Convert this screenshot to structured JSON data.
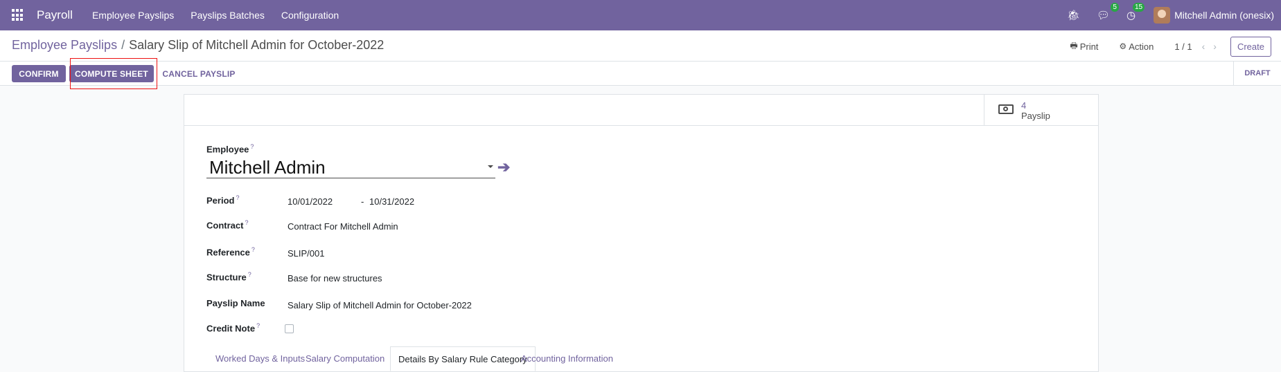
{
  "navbar": {
    "app_name": "Payroll",
    "menu": [
      "Employee Payslips",
      "Payslips Batches",
      "Configuration"
    ],
    "messages_count": "5",
    "activities_count": "15",
    "user": "Mitchell Admin (onesix)"
  },
  "control_panel": {
    "breadcrumb_parent": "Employee Payslips",
    "breadcrumb_separator": "/",
    "breadcrumb_current": "Salary Slip of Mitchell Admin for October-2022",
    "print_label": "Print",
    "action_label": "Action",
    "pager": "1 / 1",
    "create_label": "Create"
  },
  "statusbar": {
    "confirm_label": "CONFIRM",
    "compute_label": "COMPUTE SHEET",
    "cancel_label": "CANCEL PAYSLIP",
    "state": "DRAFT"
  },
  "smart_button": {
    "value": "4",
    "label": "Payslip"
  },
  "form": {
    "employee_label": "Employee",
    "employee_value": "Mitchell Admin",
    "period_label": "Period",
    "period_from": "10/01/2022",
    "period_sep": "-",
    "period_to": "10/31/2022",
    "contract_label": "Contract",
    "contract_value": "Contract For Mitchell Admin",
    "reference_label": "Reference",
    "reference_value": "SLIP/001",
    "structure_label": "Structure",
    "structure_value": "Base for new structures",
    "payslip_name_label": "Payslip Name",
    "payslip_name_value": "Salary Slip of Mitchell Admin for October-2022",
    "credit_note_label": "Credit Note",
    "help_mark": "?"
  },
  "tabs": [
    "Worked Days & Inputs",
    "Salary Computation",
    "Details By Salary Rule Category",
    "Accounting Information"
  ],
  "colors": {
    "brand": "#71639e",
    "highlight": "#ee1111",
    "badge": "#28a745"
  }
}
